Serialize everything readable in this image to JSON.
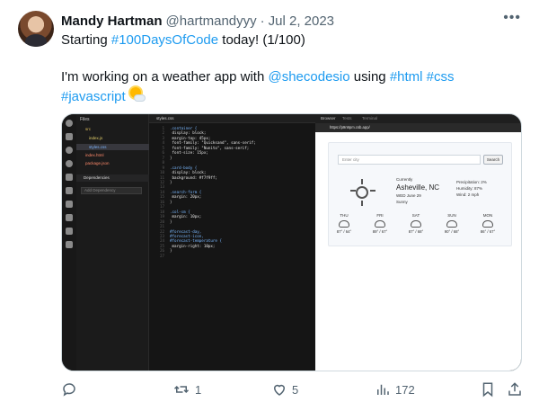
{
  "tweet": {
    "author_name": "Mandy Hartman",
    "handle": "@hartmandyyy",
    "separator": "·",
    "date": "Jul 2, 2023",
    "more_icon": "more-dots-icon",
    "line1_pre": "Starting ",
    "line1_tag": "#100DaysOfCode",
    "line1_post": " today! (1/100)",
    "line2_pre": "I'm working on a weather app with ",
    "line2_mention": "@shecodesio",
    "line2_mid": " using ",
    "line2_tag1": "#html",
    "line2_tag2": "#css",
    "line3_tag": "#javascript",
    "emoji": "sun-behind-cloud-icon",
    "link_color": "#1d9bf0"
  },
  "media": {
    "editor": {
      "explorer_title": "Files",
      "items": [
        "src",
        "index.js",
        "styles.css",
        "index.html",
        "package.json"
      ],
      "dependencies_label": "Dependencies",
      "add_dependency": "Add Dependency",
      "tab_name": "styles.css",
      "code": [
        {
          "n": "1",
          "t": ".container {",
          "k": "sel"
        },
        {
          "n": "2",
          "t": "  display: block;",
          "k": "prop"
        },
        {
          "n": "3",
          "t": "  margin-top: 45px;",
          "k": "prop"
        },
        {
          "n": "4",
          "t": "  font-family: \"Quicksand\", sans-serif;",
          "k": "prop"
        },
        {
          "n": "5",
          "t": "  font-family: \"Nunito\", sans-serif;",
          "k": "prop"
        },
        {
          "n": "6",
          "t": "  font-size: 15px;",
          "k": "prop"
        },
        {
          "n": "7",
          "t": "}",
          "k": "pun"
        },
        {
          "n": "8",
          "t": "",
          "k": "pun"
        },
        {
          "n": "9",
          "t": ".card-body {",
          "k": "sel"
        },
        {
          "n": "10",
          "t": "  display: block;",
          "k": "prop"
        },
        {
          "n": "11",
          "t": "  background: #f7f9ff;",
          "k": "prop"
        },
        {
          "n": "12",
          "t": "}",
          "k": "pun"
        },
        {
          "n": "13",
          "t": "",
          "k": "pun"
        },
        {
          "n": "14",
          "t": ".search-form {",
          "k": "sel"
        },
        {
          "n": "15",
          "t": "  margin: 20px;",
          "k": "prop"
        },
        {
          "n": "16",
          "t": "}",
          "k": "pun"
        },
        {
          "n": "17",
          "t": "",
          "k": "pun"
        },
        {
          "n": "18",
          "t": ".col-sm {",
          "k": "sel"
        },
        {
          "n": "19",
          "t": "  margin: 10px;",
          "k": "prop"
        },
        {
          "n": "20",
          "t": "}",
          "k": "pun"
        },
        {
          "n": "21",
          "t": "",
          "k": "pun"
        },
        {
          "n": "22",
          "t": "#forecast-day,",
          "k": "sel"
        },
        {
          "n": "23",
          "t": "#forecast-icon,",
          "k": "sel"
        },
        {
          "n": "24",
          "t": "#forecast-temperature {",
          "k": "sel"
        },
        {
          "n": "25",
          "t": "  margin-right: 10px;",
          "k": "prop"
        },
        {
          "n": "26",
          "t": "}",
          "k": "pun"
        },
        {
          "n": "27",
          "t": "",
          "k": "pun"
        }
      ]
    },
    "browser": {
      "tabs": [
        "Browser",
        "Tests",
        "Terminal"
      ],
      "url": "https://p9n9pm.csb.app/",
      "search_placeholder": "Enter city",
      "search_button": "Search",
      "currently": "Currently",
      "city": "Asheville, NC",
      "date": "WED June 29",
      "condition": "Sunny",
      "precipitation": "Precipitation: 2%",
      "humidity": "Humidity: 87%",
      "wind": "Wind: 2 mph",
      "forecast": [
        {
          "day": "THU",
          "temp": "87° / 64°"
        },
        {
          "day": "FRI",
          "temp": "89° / 67°"
        },
        {
          "day": "SAT",
          "temp": "87° / 68°"
        },
        {
          "day": "SUN",
          "temp": "90° / 68°"
        },
        {
          "day": "MON",
          "temp": "86° / 67°"
        }
      ]
    }
  },
  "actions": {
    "reply_icon": "reply-icon",
    "retweet_icon": "retweet-icon",
    "retweet_count": "1",
    "like_icon": "heart-icon",
    "like_count": "5",
    "views_icon": "views-chart-icon",
    "views_count": "172",
    "bookmark_icon": "bookmark-icon",
    "share_icon": "share-icon"
  }
}
